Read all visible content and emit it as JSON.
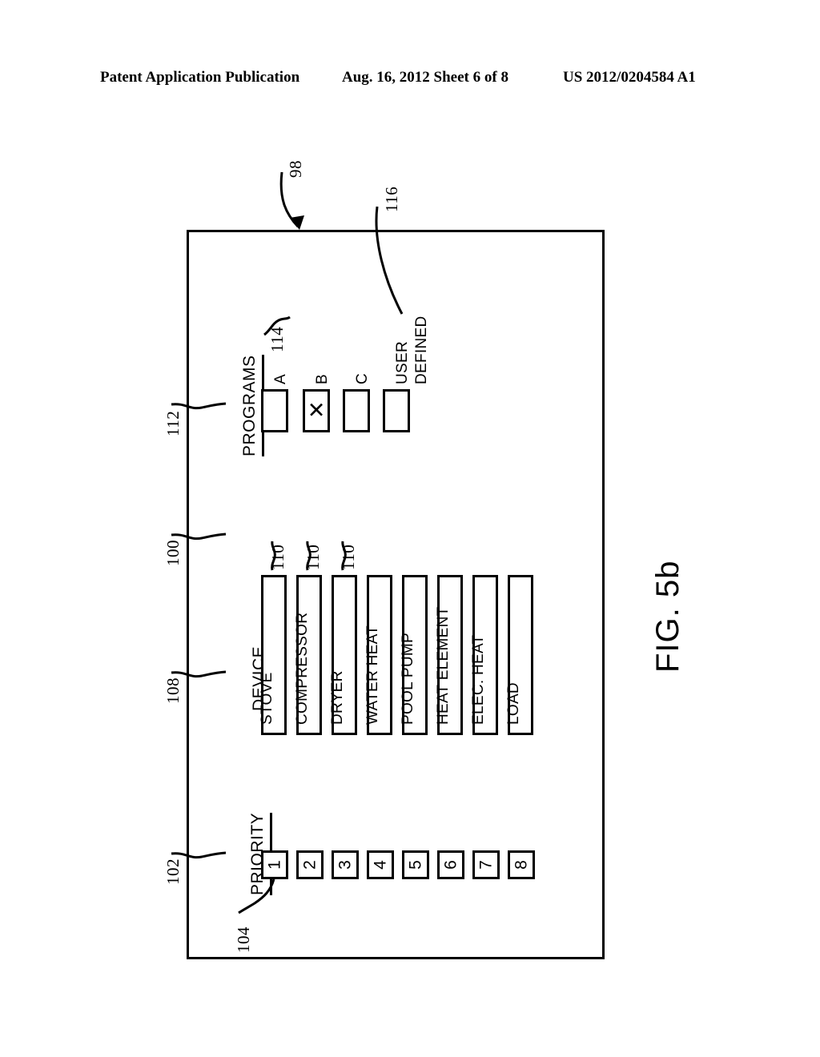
{
  "header": {
    "publication": "Patent Application Publication",
    "date_sheet": "Aug. 16, 2012  Sheet 6 of 8",
    "patent_number": "US 2012/0204584 A1"
  },
  "figure": {
    "caption": "FIG. 5b",
    "frame_ref": "98"
  },
  "priority": {
    "heading": "PRIORITY",
    "ref": "102",
    "box_ref": "104",
    "boxes": [
      "1",
      "2",
      "3",
      "4",
      "5",
      "6",
      "7",
      "8"
    ]
  },
  "device": {
    "heading": "DEVICE",
    "ref": "108",
    "group_ref": "100",
    "box_ref": "110",
    "box_refs": [
      "110",
      "110",
      "110"
    ],
    "boxes": [
      "STOVE",
      "COMPRESSOR",
      "DRYER",
      "WATER HEAT",
      "POOL PUMP",
      "HEAT ELEMENT",
      "ELEC. HEAT",
      "LOAD"
    ]
  },
  "programs": {
    "heading": "PROGRAMS",
    "ref": "112",
    "first_box_ref": "114",
    "user_defined_ref": "116",
    "options": [
      {
        "label": "A",
        "checked": false,
        "mark": ""
      },
      {
        "label": "B",
        "checked": true,
        "mark": "✕"
      },
      {
        "label": "C",
        "checked": false,
        "mark": ""
      },
      {
        "label_line1": "USER",
        "label_line2": "DEFINED",
        "checked": false,
        "mark": ""
      }
    ],
    "user_defined_line1": "USER",
    "user_defined_line2": "DEFINED"
  },
  "colors": {
    "ink": "#000000",
    "paper": "#ffffff"
  }
}
